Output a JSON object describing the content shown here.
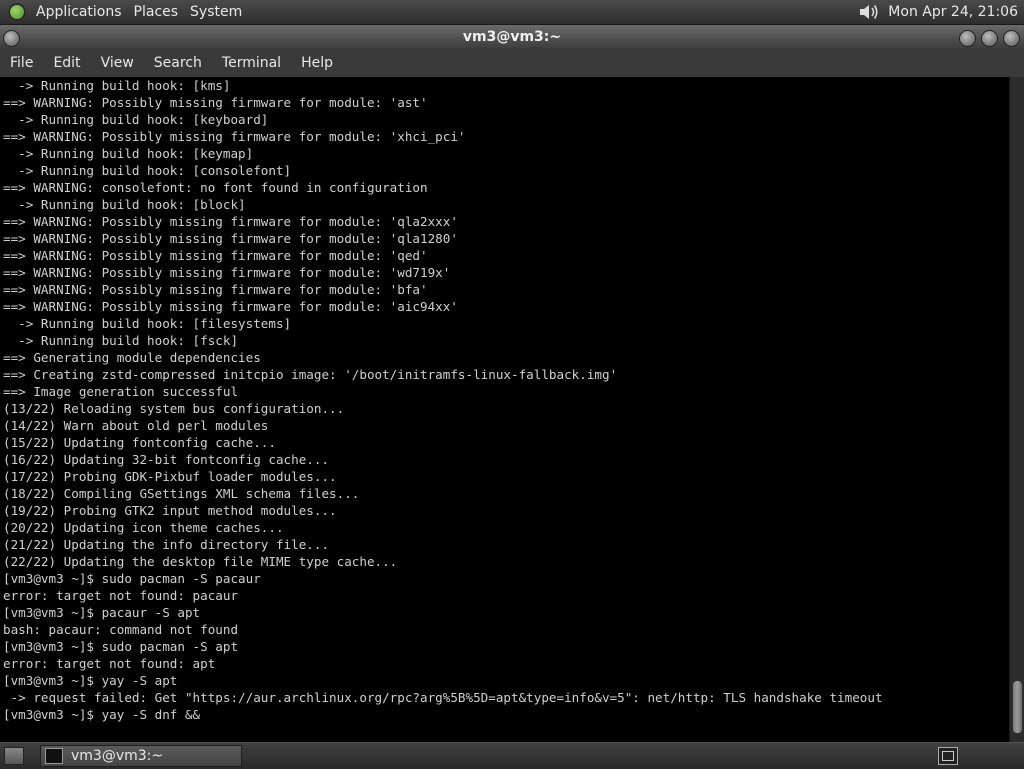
{
  "top_panel": {
    "menus": [
      "Applications",
      "Places",
      "System"
    ],
    "clock": "Mon Apr 24, 21:06"
  },
  "window": {
    "title": "vm3@vm3:~"
  },
  "menu_bar": {
    "items": [
      "File",
      "Edit",
      "View",
      "Search",
      "Terminal",
      "Help"
    ]
  },
  "terminal": {
    "lines": [
      "  -> Running build hook: [kms]",
      "==> WARNING: Possibly missing firmware for module: 'ast'",
      "  -> Running build hook: [keyboard]",
      "==> WARNING: Possibly missing firmware for module: 'xhci_pci'",
      "  -> Running build hook: [keymap]",
      "  -> Running build hook: [consolefont]",
      "==> WARNING: consolefont: no font found in configuration",
      "  -> Running build hook: [block]",
      "==> WARNING: Possibly missing firmware for module: 'qla2xxx'",
      "==> WARNING: Possibly missing firmware for module: 'qla1280'",
      "==> WARNING: Possibly missing firmware for module: 'qed'",
      "==> WARNING: Possibly missing firmware for module: 'wd719x'",
      "==> WARNING: Possibly missing firmware for module: 'bfa'",
      "==> WARNING: Possibly missing firmware for module: 'aic94xx'",
      "  -> Running build hook: [filesystems]",
      "  -> Running build hook: [fsck]",
      "==> Generating module dependencies",
      "==> Creating zstd-compressed initcpio image: '/boot/initramfs-linux-fallback.img'",
      "==> Image generation successful",
      "(13/22) Reloading system bus configuration...",
      "(14/22) Warn about old perl modules",
      "(15/22) Updating fontconfig cache...",
      "(16/22) Updating 32-bit fontconfig cache...",
      "(17/22) Probing GDK-Pixbuf loader modules...",
      "(18/22) Compiling GSettings XML schema files...",
      "(19/22) Probing GTK2 input method modules...",
      "(20/22) Updating icon theme caches...",
      "(21/22) Updating the info directory file...",
      "(22/22) Updating the desktop file MIME type cache...",
      "[vm3@vm3 ~]$ sudo pacman -S pacaur",
      "error: target not found: pacaur",
      "[vm3@vm3 ~]$ pacaur -S apt",
      "bash: pacaur: command not found",
      "[vm3@vm3 ~]$ sudo pacman -S apt",
      "error: target not found: apt",
      "[vm3@vm3 ~]$ yay -S apt",
      " -> request failed: Get \"https://aur.archlinux.org/rpc?arg%5B%5D=apt&type=info&v=5\": net/http: TLS handshake timeout",
      "[vm3@vm3 ~]$ yay -S dnf &&"
    ]
  },
  "taskbar": {
    "tasks": [
      "vm3@vm3:~"
    ]
  }
}
